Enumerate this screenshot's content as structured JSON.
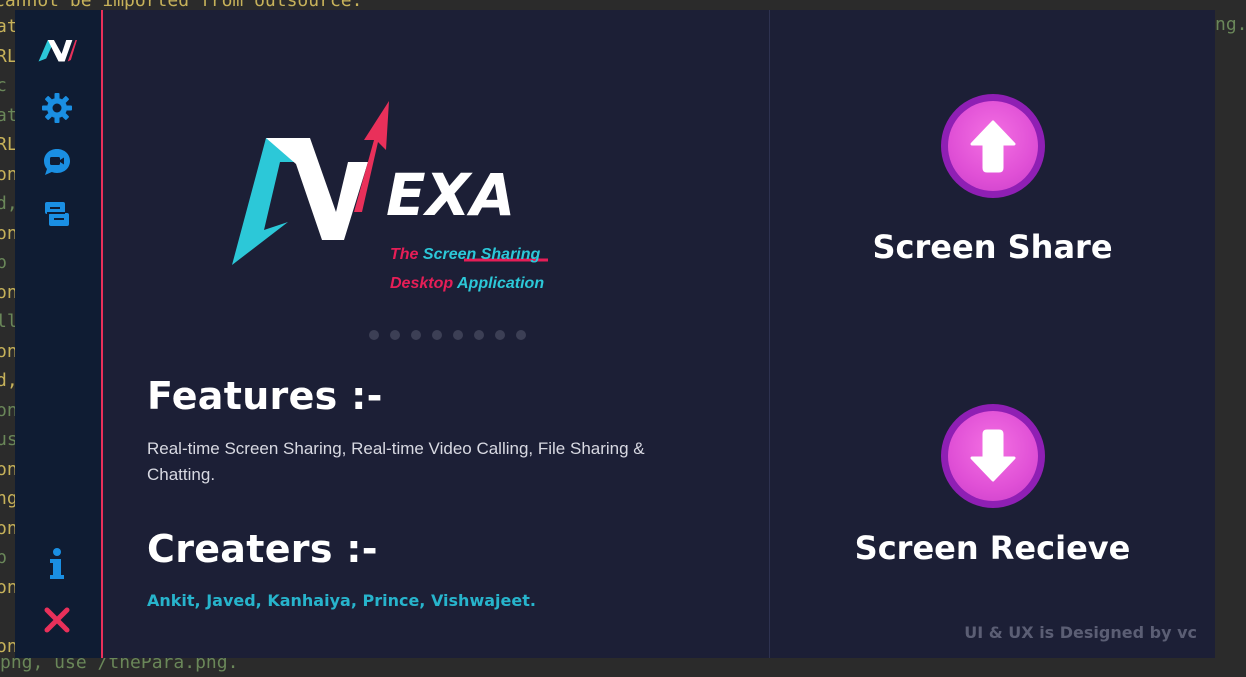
{
  "background": {
    "top_line": "cannot be imported from outsource.",
    "right_fragment": "ng.",
    "bottom_line": "png, use /thePara.png.",
    "left_fragments": [
      "at",
      "RL",
      "c",
      "at",
      "RL",
      "on",
      "d,",
      "on",
      "p",
      "on",
      "ll",
      "on",
      "d,",
      "on",
      "us",
      "on",
      "ng",
      "on",
      "p",
      "on",
      "",
      "on"
    ]
  },
  "sidebar": {
    "items": [
      {
        "icon": "nexa-logo-icon"
      },
      {
        "icon": "gear-icon"
      },
      {
        "icon": "video-chat-icon"
      },
      {
        "icon": "files-icon"
      }
    ],
    "bottom": [
      {
        "icon": "info-icon"
      },
      {
        "icon": "close-icon"
      }
    ]
  },
  "logo": {
    "wordmark": "EXA",
    "tagline_line1_a": "The",
    "tagline_line1_b": "Screen Sharing",
    "tagline_line2_a": "Desktop",
    "tagline_line2_b": "Application"
  },
  "carousel": {
    "dot_count": 8
  },
  "features": {
    "heading": "Features :-",
    "text": "Real-time Screen Sharing, Real-time Video Calling, File Sharing & Chatting."
  },
  "creators": {
    "heading": "Creaters :-",
    "names": "Ankit, Javed, Kanhaiya, Prince, Vishwajeet."
  },
  "actions": {
    "share_label": "Screen Share",
    "receive_label": "Screen Recieve"
  },
  "credit": "UI & UX is Designed by vc",
  "colors": {
    "accent_pink": "#e9305a",
    "accent_cyan": "#2cc8d8",
    "panel_bg": "#1c1f36",
    "sidebar_bg": "#0f1c33",
    "button_magenta": "#e050d6"
  }
}
